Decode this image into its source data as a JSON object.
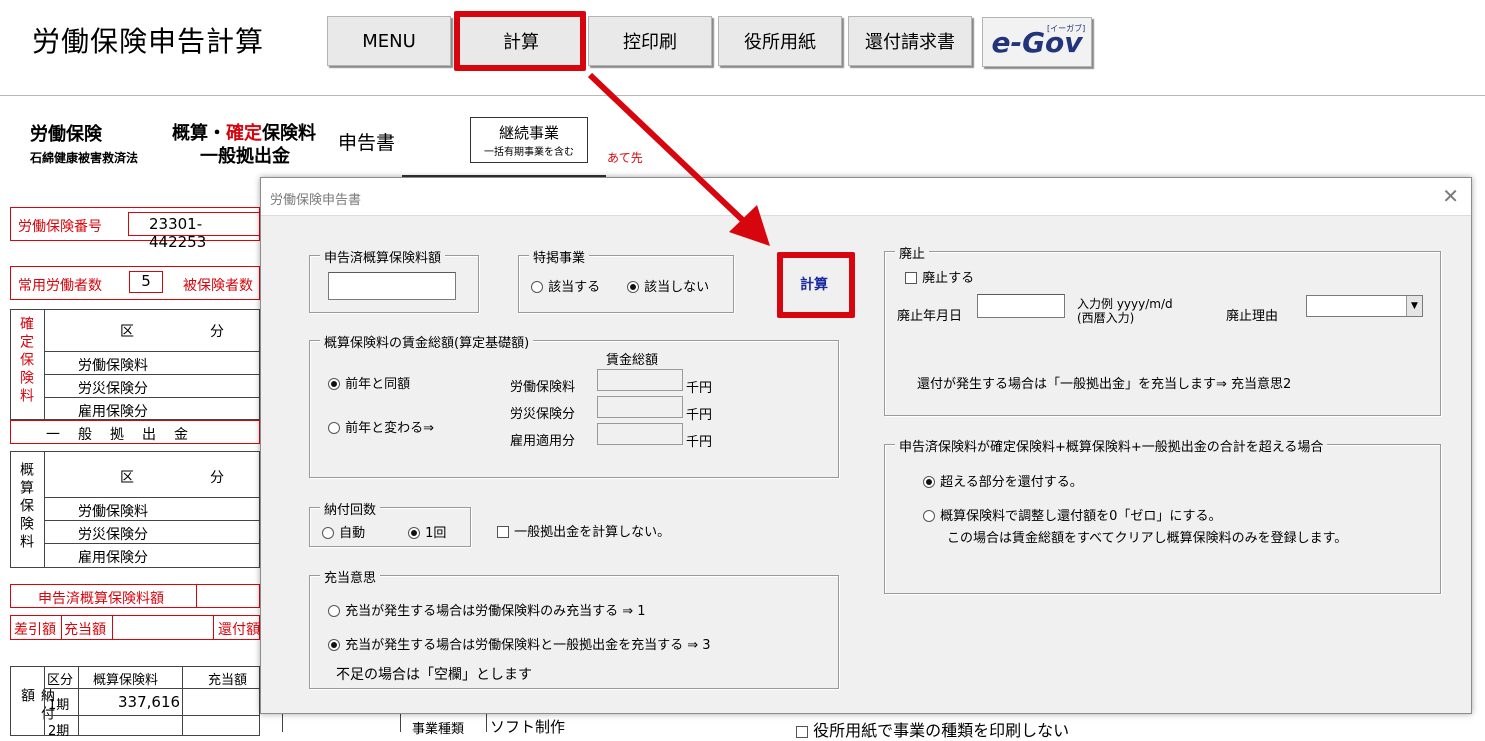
{
  "app": {
    "title": "労働保険申告計算"
  },
  "toolbar": {
    "menu_label": "MENU",
    "calc_label": "計算",
    "copy_print_label": "控印刷",
    "office_paper_label": "役所用紙",
    "refund_label": "還付請求書",
    "egov_label": "e-Gov",
    "egov_small": "[イーガブ]"
  },
  "form": {
    "ins_title": "労働保険",
    "asbestos": "石綿健康被害救済法",
    "title_est": "概算・",
    "title_fixed": "確定",
    "title_fee": "保険料",
    "title_general": "一般拠出金",
    "title_report": "申告書",
    "cont_biz": "継続事業",
    "cont_biz_sub": "一括有期事業を含む",
    "addressee": "あて先",
    "ins_no_label": "労働保険番号",
    "ins_no_value": "23301-442253",
    "workers_label": "常用労働者数",
    "workers_value": "5",
    "insured_label": "被保険者数",
    "fixed_col": "確定保険料",
    "est_col": "概算保険料",
    "div": "区",
    "cat": "分",
    "rows_fixed": [
      "労働保険料",
      "労災保険分",
      "雇用保険分"
    ],
    "general_row": "一般拠出金",
    "rows_est": [
      "労働保険料",
      "労災保険分",
      "雇用保険分"
    ],
    "reported_est": "申告済概算保険料額",
    "diff": "差引額",
    "apply": "充当額",
    "refund": "還付額",
    "pay_col": "納付額",
    "pay_div": "区分",
    "pay_est": "概算保険料",
    "pay_apply": "充当額",
    "period1": "1期",
    "period1_val": "337,616",
    "period2": "2期",
    "biz_type_label": "事業種類",
    "biz_type_value": "ソフト制作",
    "no_print_biz": "役所用紙で事業の種類を印刷しない"
  },
  "dialog": {
    "title": "労働保険申告書",
    "close_glyph": "✕",
    "reported_group": "申告済概算保険料額",
    "reported_value": "",
    "special_group": "特掲事業",
    "special_yes": "該当する",
    "special_no": "該当しない",
    "calc_button": "計算",
    "wage_group": "概算保険料の賃金総額(算定基礎額)",
    "same_as_last": "前年と同額",
    "changed": "前年と変わる⇒",
    "wage_total_header": "賃金総額",
    "wage_labour": "労働保険料",
    "wage_accident": "労災保険分",
    "wage_employment": "雇用適用分",
    "unit": "千円",
    "pay_times_group": "納付回数",
    "auto": "自動",
    "once": "1回",
    "no_general_calc": "一般拠出金を計算しない。",
    "apply_group": "充当意思",
    "apply_opt1": "充当が発生する場合は労働保険料のみ充当する ⇒ 1",
    "apply_opt3": "充当が発生する場合は労働保険料と一般拠出金を充当する ⇒ 3",
    "shortage_note": "不足の場合は「空欄」とします",
    "abolish_group": "廃止",
    "abolish_check": "廃止する",
    "abolish_date": "廃止年月日",
    "date_example": "入力例 yyyy/m/d",
    "date_western": "(西暦入力)",
    "abolish_reason": "廃止理由",
    "refund_note": "還付が発生する場合は「一般拠出金」を充当します⇒ 充当意思2",
    "excess_group": "申告済保険料が確定保険料+概算保険料+一般拠出金の合計を超える場合",
    "excess_opt1": "超える部分を還付する。",
    "excess_opt2": "概算保険料で調整し還付額を0「ゼロ」にする。",
    "excess_opt2_note": "この場合は賃金総額をすべてクリアし概算保険料のみを登録します。"
  },
  "colors": {
    "highlight": "#d7060e",
    "calc_text": "#1a2a9e",
    "form_red": "#d7060e"
  }
}
